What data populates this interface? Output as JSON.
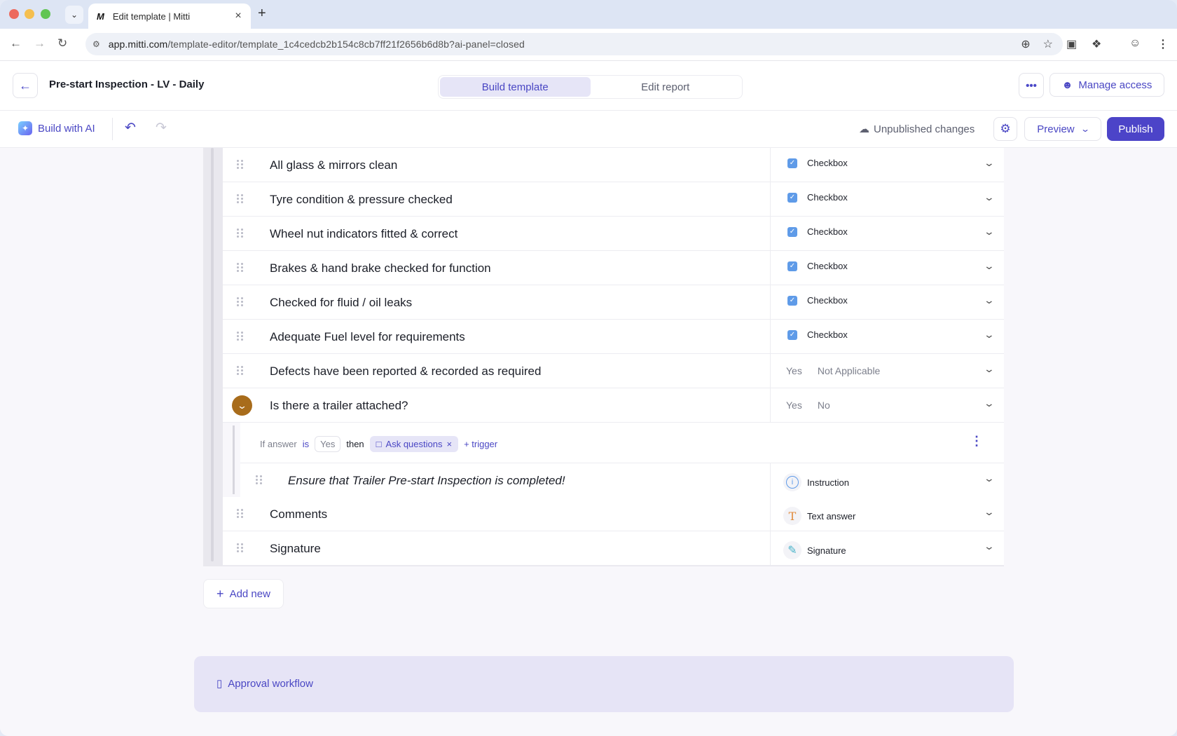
{
  "browser": {
    "tab_favicon": "M",
    "tab_title": "Edit template | Mitti",
    "url_host": "app.mitti.com",
    "url_path": "/template-editor/template_1c4cedcb2b154c8cb7ff21f2656b6d8b?ai-panel=closed"
  },
  "header": {
    "title": "Pre-start Inspection - LV - Daily",
    "tabs": [
      "Build template",
      "Edit report"
    ],
    "active_tab": "Build template",
    "manage_access": "Manage access"
  },
  "toolbar": {
    "build_ai": "Build with AI",
    "status": "Unpublished changes",
    "preview": "Preview",
    "publish": "Publish"
  },
  "questions": [
    {
      "text": "All glass & mirrors clean",
      "type": "Checkbox"
    },
    {
      "text": "Tyre condition & pressure checked",
      "type": "Checkbox"
    },
    {
      "text": "Wheel nut indicators fitted & correct",
      "type": "Checkbox"
    },
    {
      "text": "Brakes & hand brake checked for function",
      "type": "Checkbox"
    },
    {
      "text": "Checked for fluid / oil leaks",
      "type": "Checkbox"
    },
    {
      "text": "Adequate Fuel level for requirements",
      "type": "Checkbox"
    },
    {
      "text": "Defects have been reported & recorded as required",
      "options": [
        "Yes",
        "Not Applicable"
      ]
    },
    {
      "text": "Is there a trailer attached?",
      "options": [
        "Yes",
        "No"
      ]
    }
  ],
  "logic": {
    "if_answer": "If answer",
    "is": "is",
    "value": "Yes",
    "then": "then",
    "action": "Ask questions",
    "add_trigger": "+ trigger",
    "child": {
      "text": "Ensure that Trailer Pre-start Inspection is completed!",
      "type": "Instruction"
    }
  },
  "after_questions": [
    {
      "text": "Comments",
      "type": "Text answer"
    },
    {
      "text": "Signature",
      "type": "Signature"
    }
  ],
  "add_new": "Add new",
  "approval_workflow": "Approval workflow",
  "colors": {
    "accent": "#4c44c8",
    "checkbox": "#5f9be8",
    "expand": "#a86c1b"
  }
}
